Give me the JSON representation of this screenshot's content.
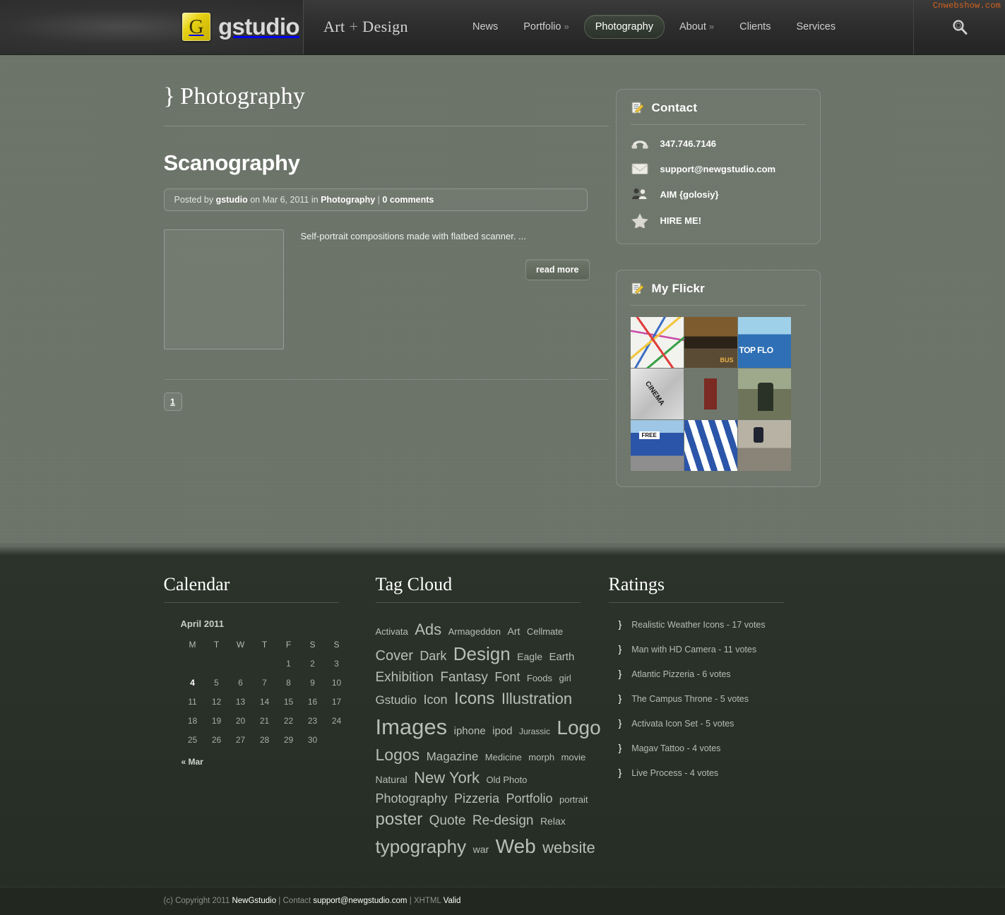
{
  "watermark": "Cnwebshow.com",
  "header": {
    "logo_letter": "G",
    "logo_word": "gstudio",
    "tagline_a": "Art",
    "tagline_plus": "+",
    "tagline_b": "Design",
    "nav": [
      {
        "label": "News",
        "caret": "",
        "active": false
      },
      {
        "label": "Portfolio",
        "caret": "»",
        "active": false
      },
      {
        "label": "Photography",
        "caret": "",
        "active": true
      },
      {
        "label": "About",
        "caret": "»",
        "active": false
      },
      {
        "label": "Clients",
        "caret": "",
        "active": false
      },
      {
        "label": "Services",
        "caret": "",
        "active": false
      }
    ],
    "search_icon": "search-icon"
  },
  "main": {
    "page_title": "Photography",
    "brace": "}",
    "post": {
      "title": "Scanography",
      "meta_prefix": "Posted by",
      "author": "gstudio",
      "meta_on": "on",
      "date": "Mar 6, 2011",
      "meta_in": "in",
      "category": "Photography",
      "divider": "|",
      "comments": "0 comments",
      "excerpt": "Self-portrait compositions made with flatbed scanner. ...",
      "read_more": "read more",
      "thumb_name": "scanography-thumbnail"
    },
    "pagination": [
      "1"
    ]
  },
  "sidebar": {
    "contact": {
      "title": "Contact",
      "icon": "note-pencil-icon",
      "items": [
        {
          "icon": "phone-icon",
          "text": "347.746.7146"
        },
        {
          "icon": "mail-icon",
          "text": "support@newgstudio.com"
        },
        {
          "icon": "users-icon",
          "text": "AIM {golosiy}"
        },
        {
          "icon": "star-icon",
          "text": "HIRE ME!"
        }
      ]
    },
    "flickr": {
      "title": "My Flickr",
      "icon": "note-pencil-icon",
      "photos": [
        "subway-map-photo",
        "city-street-bus-photo",
        "the-top-flo-sign-photo",
        "fou-cinema-poster-photo",
        "red-chair-photo",
        "people-walking-photo",
        "free-gilad-sign-photo",
        "israeli-flags-crowd-photo",
        "stairs-people-photo"
      ]
    }
  },
  "footer": {
    "calendar": {
      "heading": "Calendar",
      "month": "April 2011",
      "weekdays": [
        "M",
        "T",
        "W",
        "T",
        "F",
        "S",
        "S"
      ],
      "weeks": [
        [
          "",
          "",
          "",
          "",
          "1",
          "2",
          "3"
        ],
        [
          "4",
          "5",
          "6",
          "7",
          "8",
          "9",
          "10"
        ],
        [
          "11",
          "12",
          "13",
          "14",
          "15",
          "16",
          "17"
        ],
        [
          "18",
          "19",
          "20",
          "21",
          "22",
          "23",
          "24"
        ],
        [
          "25",
          "26",
          "27",
          "28",
          "29",
          "30",
          ""
        ]
      ],
      "today": "4",
      "prev_link": "« Mar"
    },
    "tagcloud": {
      "heading": "Tag Cloud",
      "tags": [
        {
          "label": "Activata",
          "size": 13
        },
        {
          "label": "Ads",
          "size": 22
        },
        {
          "label": "Armageddon",
          "size": 13
        },
        {
          "label": "Art",
          "size": 14
        },
        {
          "label": "Cellmate",
          "size": 13
        },
        {
          "label": "Cover",
          "size": 20
        },
        {
          "label": "Dark",
          "size": 18
        },
        {
          "label": "Design",
          "size": 26
        },
        {
          "label": "Eagle",
          "size": 14
        },
        {
          "label": "Earth",
          "size": 15
        },
        {
          "label": "Exhibition",
          "size": 19
        },
        {
          "label": "Fantasy",
          "size": 19
        },
        {
          "label": "Font",
          "size": 18
        },
        {
          "label": "Foods",
          "size": 13
        },
        {
          "label": "girl",
          "size": 13
        },
        {
          "label": "Gstudio",
          "size": 17
        },
        {
          "label": "Icon",
          "size": 18
        },
        {
          "label": "Icons",
          "size": 24
        },
        {
          "label": "Illustration",
          "size": 22
        },
        {
          "label": "Images",
          "size": 31
        },
        {
          "label": "iphone",
          "size": 15
        },
        {
          "label": "ipod",
          "size": 15
        },
        {
          "label": "Jurassic",
          "size": 12
        },
        {
          "label": "Logo",
          "size": 28
        },
        {
          "label": "Logos",
          "size": 23
        },
        {
          "label": "Magazine",
          "size": 17
        },
        {
          "label": "Medicine",
          "size": 13
        },
        {
          "label": "morph",
          "size": 13
        },
        {
          "label": "movie",
          "size": 13
        },
        {
          "label": "Natural",
          "size": 14
        },
        {
          "label": "New York",
          "size": 22
        },
        {
          "label": "Old Photo",
          "size": 13
        },
        {
          "label": "Photography",
          "size": 18
        },
        {
          "label": "Pizzeria",
          "size": 18
        },
        {
          "label": "Portfolio",
          "size": 18
        },
        {
          "label": "portrait",
          "size": 13
        },
        {
          "label": "poster",
          "size": 24
        },
        {
          "label": "Quote",
          "size": 19
        },
        {
          "label": "Re-design",
          "size": 19
        },
        {
          "label": "Relax",
          "size": 14
        },
        {
          "label": "typography",
          "size": 26
        },
        {
          "label": "war",
          "size": 14
        },
        {
          "label": "Web",
          "size": 28
        },
        {
          "label": "website",
          "size": 22
        }
      ]
    },
    "ratings": {
      "heading": "Ratings",
      "bullet": "}",
      "items": [
        "Realistic Weather Icons - 17 votes",
        "Man with HD Camera - 11 votes",
        "Atlantic Pizzeria - 6 votes",
        "The Campus Throne - 5 votes",
        "Activata Icon Set - 5 votes",
        "Magav Tattoo - 4 votes",
        "Live Process - 4 votes"
      ]
    },
    "copyright": {
      "prefix": "(c) Copyright 2011",
      "brand": "NewGstudio",
      "sep1": "|",
      "contact_label": "Contact",
      "email": "support@newgstudio.com",
      "sep2": "|",
      "xhtml_label": "XHTML",
      "valid_label": "Valid"
    }
  },
  "colors": {
    "body_bg": "#6c7469",
    "header_bg": "#2e2e2e",
    "footer_bg": "#2b332a",
    "copybar_bg": "#22281f",
    "accent_yellow": "#e8d317",
    "watermark_orange": "#d4641f"
  }
}
